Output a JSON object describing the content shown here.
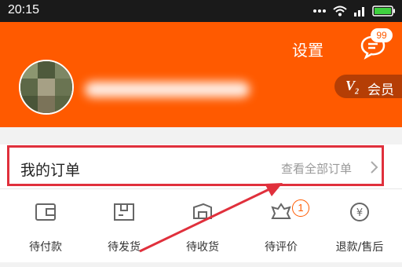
{
  "status_bar": {
    "time": "20:15"
  },
  "header": {
    "settings_label": "设置",
    "message_badge": "99",
    "vip_letter": "V",
    "vip_level": "2",
    "vip_label": "会员"
  },
  "orders": {
    "title": "我的订单",
    "view_all": "查看全部订单"
  },
  "order_items": [
    {
      "label": "待付款",
      "icon": "wallet-icon"
    },
    {
      "label": "待发货",
      "icon": "package-icon"
    },
    {
      "label": "待收货",
      "icon": "delivery-truck-icon"
    },
    {
      "label": "待评价",
      "icon": "review-icon",
      "badge": "1"
    },
    {
      "label": "退款/售后",
      "icon": "refund-icon"
    }
  ],
  "colors": {
    "brand": "#ff5a00",
    "annotation": "#e0303c"
  }
}
